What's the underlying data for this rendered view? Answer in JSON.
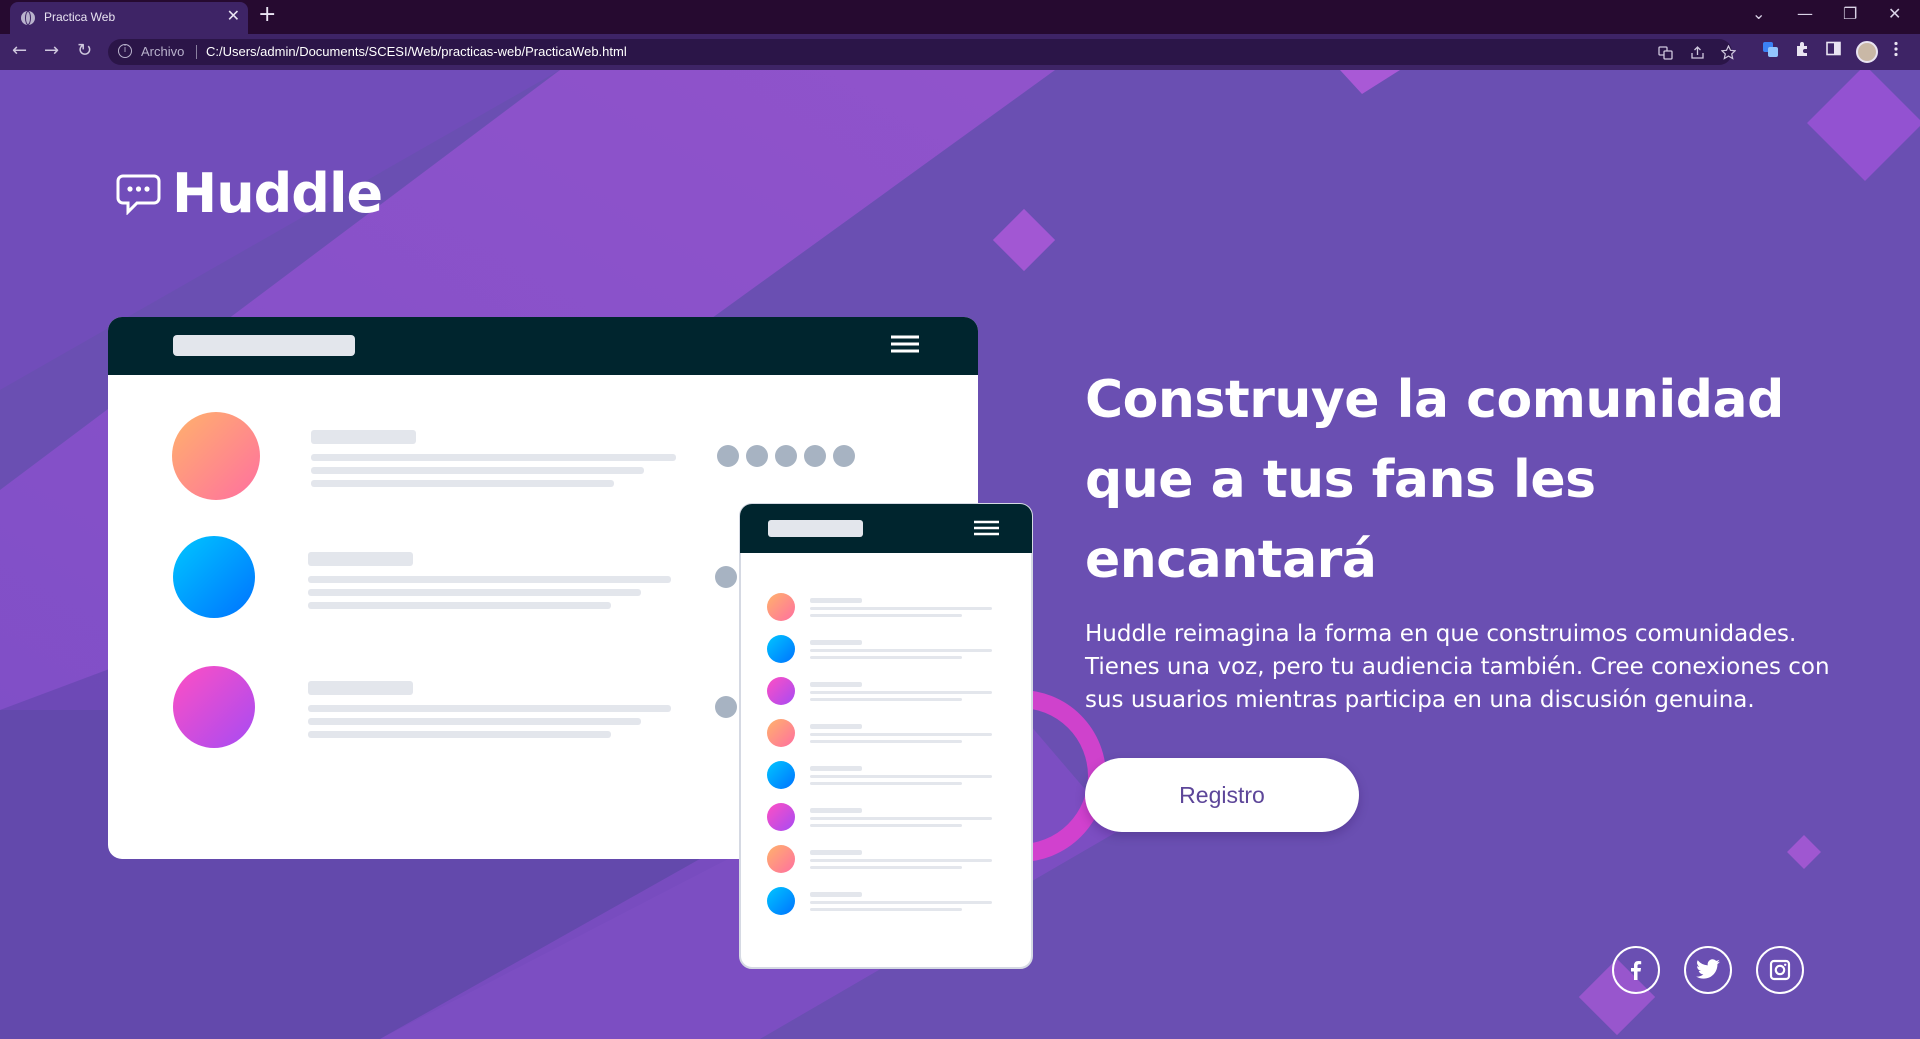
{
  "browser": {
    "tab_title": "Practica Web",
    "tab_close": "✕",
    "new_tab": "+",
    "window_controls": {
      "tabsearch": "⌄",
      "minimize": "—",
      "restore": "❐",
      "close": "✕"
    },
    "nav": {
      "back": "←",
      "forward": "→",
      "reload": "↻"
    },
    "address": {
      "info": "i",
      "scheme_label": "Archivo",
      "url": "C:/Users/admin/Documents/SCESI/Web/practicas-web/PracticaWeb.html"
    }
  },
  "page": {
    "brand": "Huddle",
    "hero": {
      "heading_lines": [
        "Construye la comunidad",
        "que a tus fans les",
        "encantará"
      ],
      "description": "Huddle reimagina la forma en que construimos comunidades. Tienes una voz, pero tu audiencia también. Cree conexiones con sus usuarios mientras participa en una discusión genuina.",
      "cta_label": "Registro"
    },
    "social": [
      {
        "name": "facebook",
        "icon": "facebook-icon"
      },
      {
        "name": "twitter",
        "icon": "twitter-icon"
      },
      {
        "name": "instagram",
        "icon": "instagram-icon"
      }
    ]
  },
  "colors": {
    "page_bg": "#6a4fb2",
    "accent_purple": "#9a52d6",
    "mockup_header": "#00252e",
    "button_text": "#5d4699"
  }
}
